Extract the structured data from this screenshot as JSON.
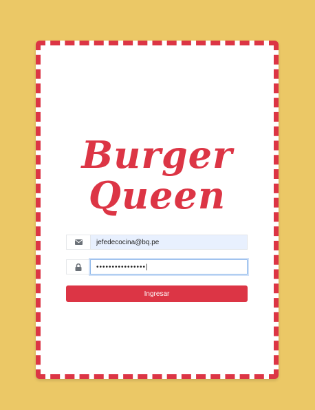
{
  "logo": {
    "line1": "Burger",
    "line2": "Queen"
  },
  "login": {
    "email": {
      "icon": "envelope-icon",
      "value": "jefedecocina@bq.pe"
    },
    "password": {
      "icon": "lock-icon",
      "value": "••••••••••••••••|"
    },
    "submit_label": "Ingresar"
  },
  "colors": {
    "background": "#EBC866",
    "accent": "#DC3545",
    "card": "#FFFFFF",
    "autofill": "#E8F0FE"
  }
}
